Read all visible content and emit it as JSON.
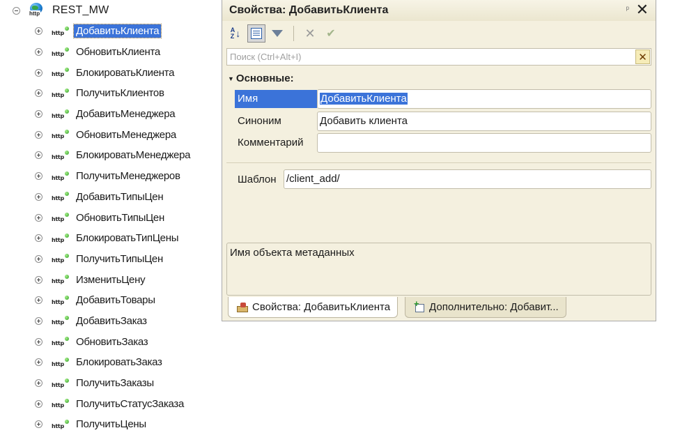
{
  "tree": {
    "root": {
      "label": "REST_MW",
      "icon_tag": "http"
    },
    "items": [
      {
        "label": "ДобавитьКлиента",
        "selected": true
      },
      {
        "label": "ОбновитьКлиента"
      },
      {
        "label": "БлокироватьКлиента"
      },
      {
        "label": "ПолучитьКлиентов"
      },
      {
        "label": "ДобавитьМенеджера"
      },
      {
        "label": "ОбновитьМенеджера"
      },
      {
        "label": "БлокироватьМенеджера"
      },
      {
        "label": "ПолучитьМенеджеров"
      },
      {
        "label": "ДобавитьТипыЦен"
      },
      {
        "label": "ОбновитьТипыЦен"
      },
      {
        "label": "БлокироватьТипЦены"
      },
      {
        "label": "ПолучитьТипыЦен"
      },
      {
        "label": "ИзменитьЦену"
      },
      {
        "label": "ДобавитьТовары"
      },
      {
        "label": "ДобавитьЗаказ"
      },
      {
        "label": "ОбновитьЗаказ"
      },
      {
        "label": "БлокироватьЗаказ"
      },
      {
        "label": "ПолучитьЗаказы"
      },
      {
        "label": "ПолучитьСтатусЗаказа"
      },
      {
        "label": "ПолучитьЦены"
      }
    ],
    "item_icon_tag": "http"
  },
  "panel": {
    "title": "Свойства: ДобавитьКлиента",
    "pin_glyph": "ᵖ",
    "close_glyph": "✕",
    "toolbar": {
      "sort_top": "A",
      "sort_bottom": "Z",
      "delete_glyph": "✕",
      "apply_glyph": "✔"
    },
    "search": {
      "placeholder": "Поиск (Ctrl+Alt+I)",
      "value": "",
      "clear_glyph": "✕"
    },
    "group": {
      "label": "Основные:"
    },
    "props": {
      "name": {
        "label": "Имя",
        "value": "ДобавитьКлиента"
      },
      "synonym": {
        "label": "Синоним",
        "value": "Добавить клиента"
      },
      "comment": {
        "label": "Комментарий",
        "value": ""
      },
      "template": {
        "label": "Шаблон",
        "value": "/client_add/"
      }
    },
    "description": "Имя объекта метаданных",
    "tabs": [
      {
        "label": "Свойства: ДобавитьКлиента",
        "active": true
      },
      {
        "label": "Дополнительно: Добавит..."
      }
    ]
  },
  "colors": {
    "selection": "#3b73d9",
    "panel_bg": "#f4f0df",
    "header_bg": "#ebe6cf"
  }
}
